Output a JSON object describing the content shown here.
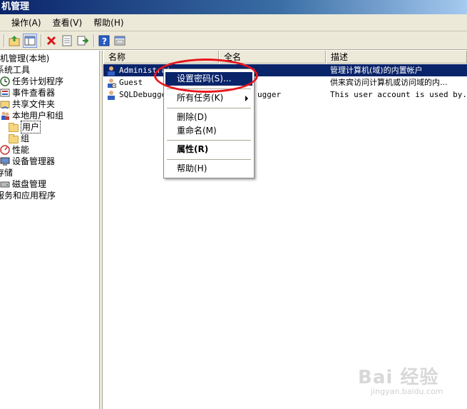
{
  "window": {
    "title": "机管理"
  },
  "menu": [
    "操作(A)",
    "查看(V)",
    "帮助(H)"
  ],
  "toolbar_icons": [
    "up-folder-icon",
    "show-hide-tree-icon",
    "delete-icon",
    "properties-icon",
    "export-icon",
    "help-icon",
    "console-icon"
  ],
  "tree": {
    "items": [
      {
        "label": "机管理(本地)",
        "icon": "computer-icon"
      },
      {
        "label": "系统工具",
        "icon": "tools-icon"
      },
      {
        "label": "任务计划程序",
        "icon": "clock-icon"
      },
      {
        "label": "事件查看器",
        "icon": "event-viewer-icon"
      },
      {
        "label": "共享文件夹",
        "icon": "shared-folder-icon"
      },
      {
        "label": "本地用户和组",
        "icon": "users-icon"
      },
      {
        "label": "用户",
        "icon": "folder-icon"
      },
      {
        "label": "组",
        "icon": "folder-icon"
      },
      {
        "label": "性能",
        "icon": "performance-icon"
      },
      {
        "label": "设备管理器",
        "icon": "device-manager-icon"
      },
      {
        "label": "存储",
        "icon": "storage-icon"
      },
      {
        "label": "磁盘管理",
        "icon": "disk-icon"
      },
      {
        "label": "服务和应用程序",
        "icon": "services-icon"
      }
    ]
  },
  "list": {
    "columns": [
      "名称",
      "全名",
      "描述"
    ],
    "rows": [
      {
        "name": "Administrator",
        "fullname": "",
        "desc": "管理计算机(域)的内置帐户"
      },
      {
        "name": "Guest",
        "fullname": "",
        "desc": "供来宾访问计算机或访问域的内..."
      },
      {
        "name": "SQLDebugger",
        "fullname": "ugger",
        "desc": "This user account is used by..."
      }
    ]
  },
  "context_menu": {
    "set_password": "设置密码(S)...",
    "all_tasks": "所有任务(K)",
    "delete": "删除(D)",
    "rename": "重命名(M)",
    "properties": "属性(R)",
    "help": "帮助(H)"
  },
  "watermark": {
    "text": "Bai 经验",
    "sub": "jingyan.baidu.com"
  },
  "colors": {
    "selection": "#0a246a",
    "highlight_ring": "#e8141c",
    "chrome": "#ece9d8"
  }
}
